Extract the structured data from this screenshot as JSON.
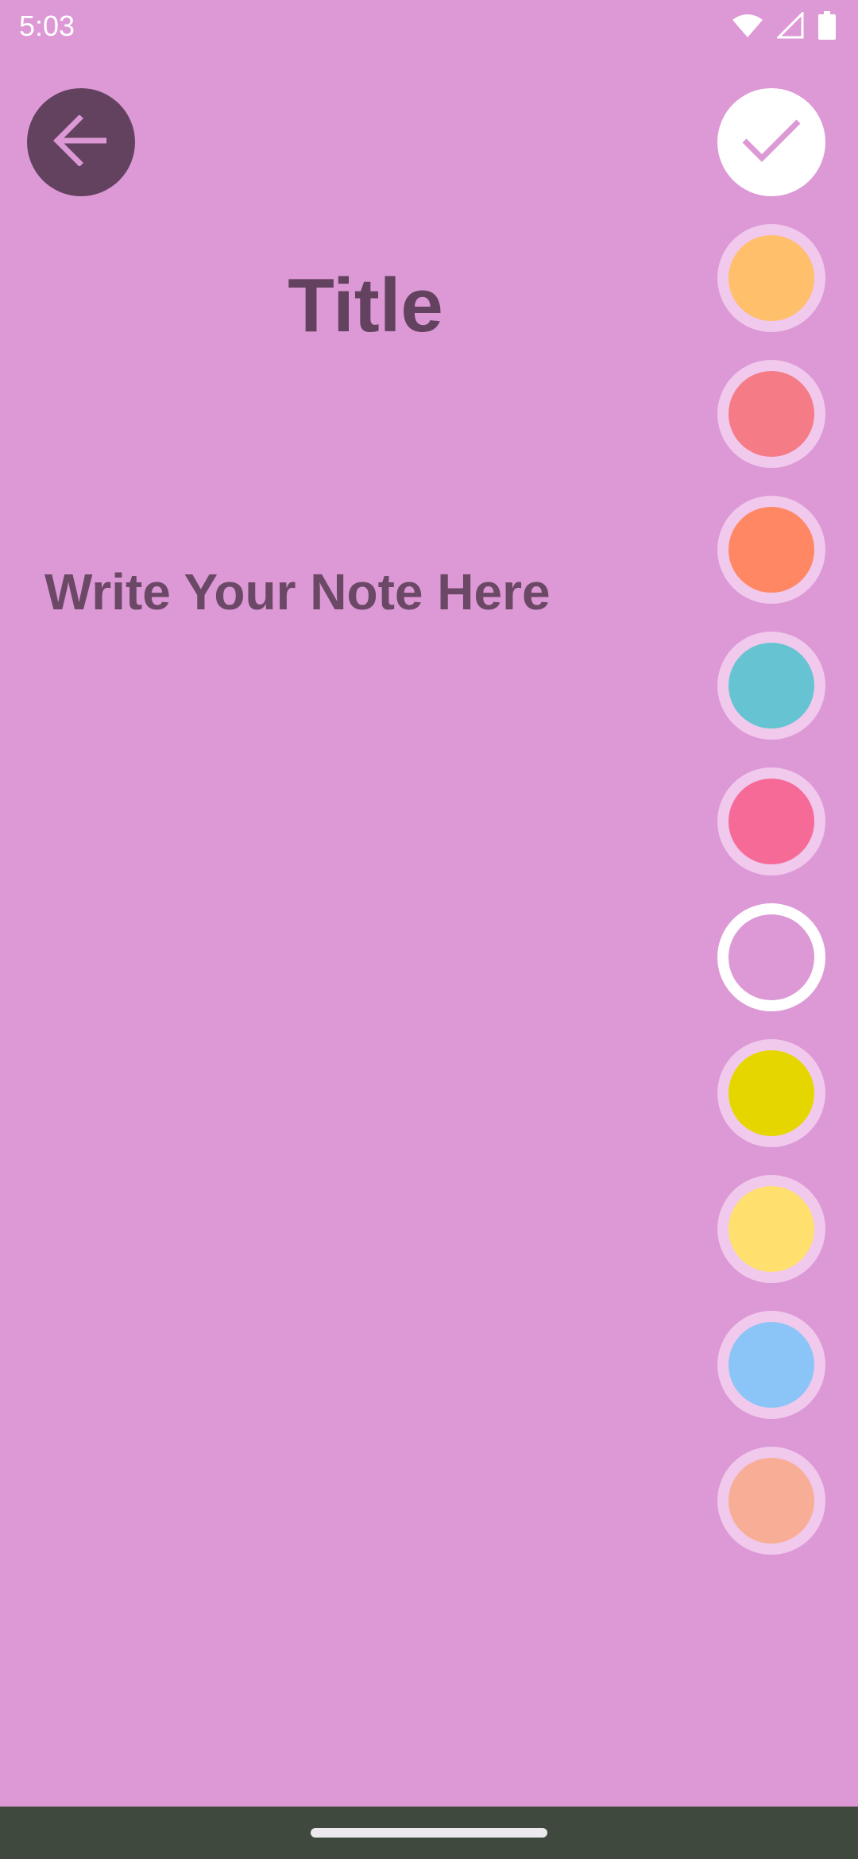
{
  "status_bar": {
    "time": "5:03",
    "icons": [
      "wifi-icon",
      "signal-icon",
      "battery-icon"
    ]
  },
  "header": {
    "back_icon": "arrow-left-icon",
    "save_icon": "check-icon"
  },
  "editor": {
    "title_placeholder": "Title",
    "note_placeholder": "Write Your Note Here"
  },
  "colors": {
    "background": "#dd98d6",
    "text": "#62425f",
    "swatches": [
      {
        "name": "orange-light",
        "hex": "#ffbf6b"
      },
      {
        "name": "rose",
        "hex": "#f57b87"
      },
      {
        "name": "coral",
        "hex": "#ff8763"
      },
      {
        "name": "teal",
        "hex": "#66c4d2"
      },
      {
        "name": "pink",
        "hex": "#f66a98"
      },
      {
        "name": "orchid",
        "hex": "#dd98d6",
        "selected": true
      },
      {
        "name": "yellow",
        "hex": "#e6d600"
      },
      {
        "name": "pale-yellow",
        "hex": "#ffe06f"
      },
      {
        "name": "sky-blue",
        "hex": "#8bc5f7"
      },
      {
        "name": "peach",
        "hex": "#f8ae96"
      }
    ]
  }
}
